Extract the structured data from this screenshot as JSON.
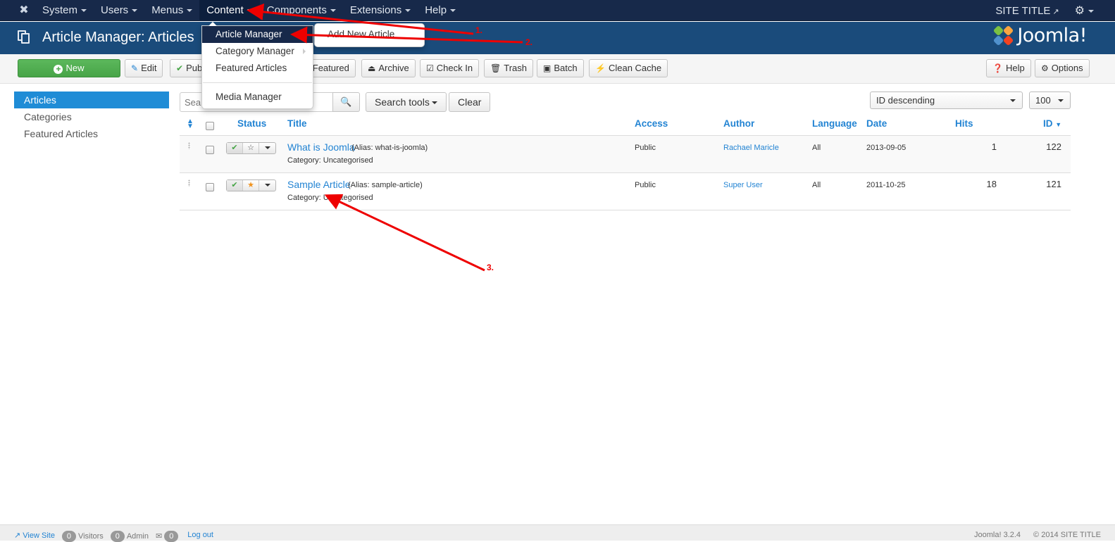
{
  "navbar": {
    "logo_icon": "joomla-icon",
    "menu": [
      {
        "label": "System"
      },
      {
        "label": "Users"
      },
      {
        "label": "Menus"
      },
      {
        "label": "Content"
      },
      {
        "label": "Components"
      },
      {
        "label": "Extensions"
      },
      {
        "label": "Help"
      }
    ],
    "site_title": "SITE TITLE",
    "site_title_icon": "external-link-icon",
    "settings_icon": "gear-icon"
  },
  "content_menu": {
    "items": [
      {
        "label": "Article Manager",
        "has_submenu": true
      },
      {
        "label": "Category Manager",
        "has_submenu": true
      },
      {
        "label": "Featured Articles"
      },
      {
        "label": "Media Manager"
      }
    ],
    "submenu": {
      "items": [
        {
          "label": "Add New Article"
        }
      ]
    }
  },
  "header": {
    "title": "Article Manager: Articles",
    "logo_text": "Joomla!",
    "brand_colors": {
      "green": "#7ac143",
      "orange": "#f9a541",
      "red": "#f44321",
      "blue": "#5091cd"
    }
  },
  "toolbar": {
    "new": "New",
    "edit": "Edit",
    "publish": "Publish",
    "featured": "Featured",
    "archive": "Archive",
    "check_in": "Check In",
    "trash": "Trash",
    "batch": "Batch",
    "clean_cache": "Clean Cache",
    "help": "Help",
    "options": "Options"
  },
  "sidebar": {
    "items": [
      {
        "label": "Articles",
        "active": true
      },
      {
        "label": "Categories"
      },
      {
        "label": "Featured Articles"
      }
    ]
  },
  "filters": {
    "search_placeholder": "Search",
    "search_tools": "Search tools",
    "clear": "Clear",
    "ordering": "ID descending",
    "limit": "100"
  },
  "table": {
    "columns": [
      "Status",
      "Title",
      "Access",
      "Author",
      "Language",
      "Date",
      "Hits",
      "ID"
    ],
    "rows": [
      {
        "title": "What is Joomla",
        "alias": "(Alias: what-is-joomla)",
        "category": "Category: Uncategorised",
        "featured": false,
        "published": true,
        "access": "Public",
        "author": "Rachael Maricle",
        "language": "All",
        "date": "2013-09-05",
        "hits": "1",
        "id": "122"
      },
      {
        "title": "Sample Article",
        "alias": "(Alias: sample-article)",
        "category": "Category: Uncategorised",
        "featured": true,
        "published": true,
        "access": "Public",
        "author": "Super User",
        "language": "All",
        "date": "2011-10-25",
        "hits": "18",
        "id": "121"
      }
    ]
  },
  "annotations": {
    "color": "#ee0000",
    "labels": [
      "1.",
      "2.",
      "3."
    ]
  },
  "footer": {
    "view_site": "View Site",
    "visitors": "Visitors",
    "visitors_count": "0",
    "admin": "Admin",
    "admin_count": "0",
    "messages_count": "0",
    "logout": "Log out",
    "version": "Joomla! 3.2.4",
    "copyright": "© 2014 SITE TITLE"
  }
}
